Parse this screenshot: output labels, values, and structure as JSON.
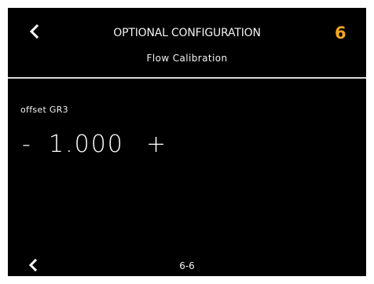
{
  "header": {
    "back_icon": "chevron-left-icon",
    "title": "OPTIONAL CONFIGURATION",
    "subtitle": "Flow Calibration",
    "step_badge": "6",
    "step_badge_color": "#f5a623"
  },
  "parameter": {
    "label": "offset GR3",
    "decrement_label": "-",
    "value": "1.000",
    "increment_label": "+"
  },
  "footer": {
    "back_icon": "chevron-left-icon",
    "page_indicator": "6-6"
  },
  "colors": {
    "background": "#000000",
    "text": "#ffffff",
    "divider": "#d9d9d9",
    "accent": "#f5a623"
  }
}
